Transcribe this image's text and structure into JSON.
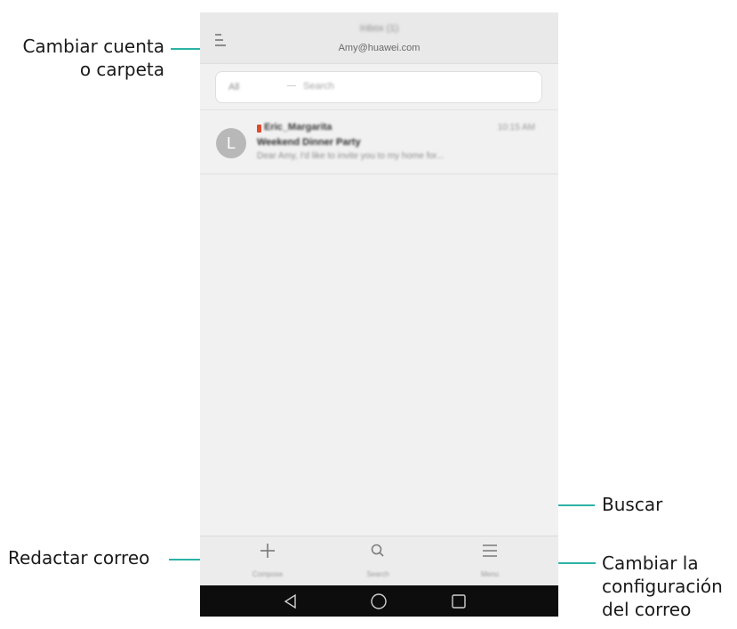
{
  "callouts": {
    "account_folder": [
      "Cambiar cuenta",
      "o carpeta"
    ],
    "search": "Buscar",
    "compose": "Redactar correo",
    "settings": [
      "Cambiar la",
      "configuración",
      "del correo"
    ]
  },
  "header": {
    "title": "Inbox (1)",
    "subtitle": "Amy@huawei.com"
  },
  "search": {
    "filter": "All",
    "placeholder": "Search"
  },
  "mail": {
    "avatar_letter": "L",
    "sender": "Eric_Margarita",
    "time": "10:15 AM",
    "subject": "Weekend Dinner Party",
    "preview": "Dear Amy, I'd like to invite you to my home for..."
  },
  "bottom_bar": {
    "compose_label": "Compose",
    "search_label": "Search",
    "menu_label": "Menu"
  },
  "icons": {
    "compose": "plus-icon",
    "search": "magnifier-icon",
    "menu": "hamburger-icon",
    "nav_back": "triangle-back-icon",
    "nav_home": "circle-home-icon",
    "nav_recent": "square-recent-icon"
  },
  "colors": {
    "leader_line": "#2bb3a6",
    "flag": "#e04a2e",
    "avatar": "#b8b8b8",
    "nav_bar": "#0d0d0d"
  }
}
